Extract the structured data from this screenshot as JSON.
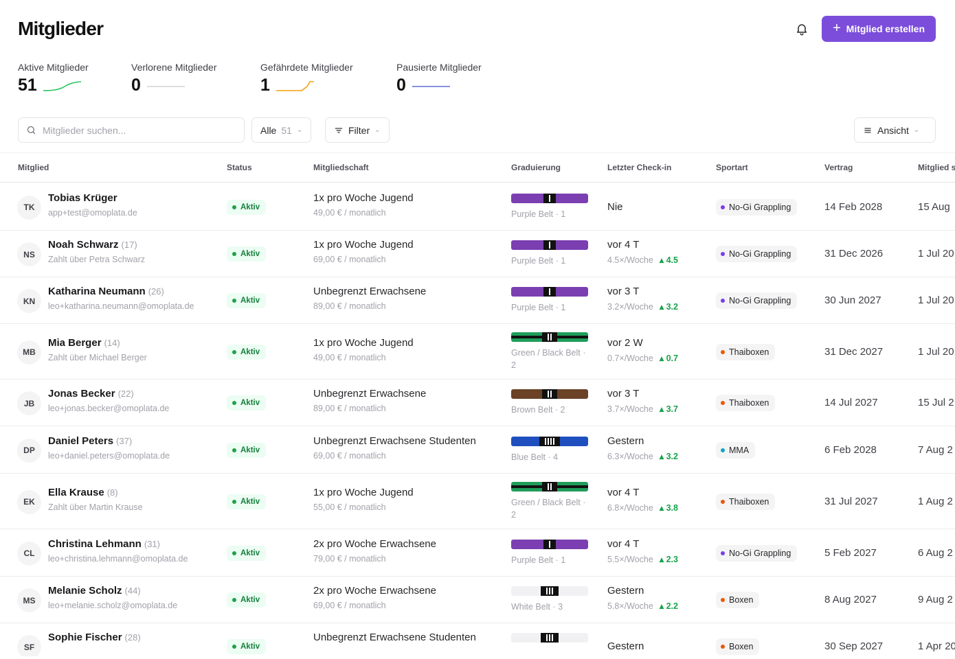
{
  "header": {
    "title": "Mitglieder",
    "create_label": "Mitglied erstellen"
  },
  "stats": [
    {
      "label": "Aktive Mitglieder",
      "value": "51",
      "color": "#22c55e"
    },
    {
      "label": "Verlorene Mitglieder",
      "value": "0",
      "color": "#d4d4d8"
    },
    {
      "label": "Gefährdete Mitglieder",
      "value": "1",
      "color": "#f59e0b"
    },
    {
      "label": "Pausierte Mitglieder",
      "value": "0",
      "color": "#5b6ed8"
    }
  ],
  "toolbar": {
    "search_placeholder": "Mitglieder suchen...",
    "all_label": "Alle",
    "all_count": "51",
    "filter_label": "Filter",
    "view_label": "Ansicht"
  },
  "columns": [
    "Mitglied",
    "Status",
    "Mitgliedschaft",
    "Graduierung",
    "Letzter Check-in",
    "Sportart",
    "Vertrag",
    "Mitglied s"
  ],
  "members": [
    {
      "initials": "TK",
      "name": "Tobias Krüger",
      "age": "",
      "sub": "app+test@omoplata.de",
      "status": "Aktiv",
      "plan": "1x pro Woche Jugend",
      "price": "49,00 € / monatlich",
      "belt": "Purple Belt · 1",
      "belt_main": "#7b3fb1",
      "belt_edge": "",
      "stripes": 1,
      "checkin": "Nie",
      "freq": "",
      "trend": "",
      "sport": "No-Gi Grappling",
      "sport_color": "#7c3aed",
      "contract": "14 Feb 2028",
      "since": "15 Aug"
    },
    {
      "initials": "NS",
      "name": "Noah Schwarz",
      "age": "(17)",
      "sub": "Zahlt über Petra Schwarz",
      "status": "Aktiv",
      "plan": "1x pro Woche Jugend",
      "price": "69,00 € / monatlich",
      "belt": "Purple Belt · 1",
      "belt_main": "#7b3fb1",
      "belt_edge": "",
      "stripes": 1,
      "checkin": "vor 4 T",
      "freq": "4.5×/Woche",
      "trend": "4.5",
      "sport": "No-Gi Grappling",
      "sport_color": "#7c3aed",
      "contract": "31 Dec 2026",
      "since": "1 Jul 20"
    },
    {
      "initials": "KN",
      "name": "Katharina Neumann",
      "age": "(26)",
      "sub": "leo+katharina.neumann@omoplata.de",
      "status": "Aktiv",
      "plan": "Unbegrenzt Erwachsene",
      "price": "89,00 € / monatlich",
      "belt": "Purple Belt · 1",
      "belt_main": "#7b3fb1",
      "belt_edge": "",
      "stripes": 1,
      "checkin": "vor 3 T",
      "freq": "3.2×/Woche",
      "trend": "3.2",
      "sport": "No-Gi Grappling",
      "sport_color": "#7c3aed",
      "contract": "30 Jun 2027",
      "since": "1 Jul 20"
    },
    {
      "initials": "MB",
      "name": "Mia Berger",
      "age": "(14)",
      "sub": "Zahlt über Michael Berger",
      "status": "Aktiv",
      "plan": "1x pro Woche Jugend",
      "price": "49,00 € / monatlich",
      "belt": "Green / Black Belt · 2",
      "belt_main": "#1f9d5a",
      "belt_edge": "#111111",
      "stripes": 2,
      "checkin": "vor 2 W",
      "freq": "0.7×/Woche",
      "trend": "0.7",
      "sport": "Thaiboxen",
      "sport_color": "#ea580c",
      "contract": "31 Dec 2027",
      "since": "1 Jul 20"
    },
    {
      "initials": "JB",
      "name": "Jonas Becker",
      "age": "(22)",
      "sub": "leo+jonas.becker@omoplata.de",
      "status": "Aktiv",
      "plan": "Unbegrenzt Erwachsene",
      "price": "89,00 € / monatlich",
      "belt": "Brown Belt · 2",
      "belt_main": "#6b4226",
      "belt_edge": "",
      "stripes": 2,
      "checkin": "vor 3 T",
      "freq": "3.7×/Woche",
      "trend": "3.7",
      "sport": "Thaiboxen",
      "sport_color": "#ea580c",
      "contract": "14 Jul 2027",
      "since": "15 Jul 2"
    },
    {
      "initials": "DP",
      "name": "Daniel Peters",
      "age": "(37)",
      "sub": "leo+daniel.peters@omoplata.de",
      "status": "Aktiv",
      "plan": "Unbegrenzt Erwachsene Studenten",
      "price": "69,00 € / monatlich",
      "belt": "Blue Belt · 4",
      "belt_main": "#1f4fbf",
      "belt_edge": "",
      "stripes": 4,
      "checkin": "Gestern",
      "freq": "6.3×/Woche",
      "trend": "3.2",
      "sport": "MMA",
      "sport_color": "#0ea5c6",
      "contract": "6 Feb 2028",
      "since": "7 Aug 2"
    },
    {
      "initials": "EK",
      "name": "Ella Krause",
      "age": "(8)",
      "sub": "Zahlt über Martin Krause",
      "status": "Aktiv",
      "plan": "1x pro Woche Jugend",
      "price": "55,00 € / monatlich",
      "belt": "Green / Black Belt · 2",
      "belt_main": "#1f9d5a",
      "belt_edge": "#111111",
      "stripes": 2,
      "checkin": "vor 4 T",
      "freq": "6.8×/Woche",
      "trend": "3.8",
      "sport": "Thaiboxen",
      "sport_color": "#ea580c",
      "contract": "31 Jul 2027",
      "since": "1 Aug 2"
    },
    {
      "initials": "CL",
      "name": "Christina Lehmann",
      "age": "(31)",
      "sub": "leo+christina.lehmann@omoplata.de",
      "status": "Aktiv",
      "plan": "2x pro Woche Erwachsene",
      "price": "79,00 € / monatlich",
      "belt": "Purple Belt · 1",
      "belt_main": "#7b3fb1",
      "belt_edge": "",
      "stripes": 1,
      "checkin": "vor 4 T",
      "freq": "5.5×/Woche",
      "trend": "2.3",
      "sport": "No-Gi Grappling",
      "sport_color": "#7c3aed",
      "contract": "5 Feb 2027",
      "since": "6 Aug 2"
    },
    {
      "initials": "MS",
      "name": "Melanie Scholz",
      "age": "(44)",
      "sub": "leo+melanie.scholz@omoplata.de",
      "status": "Aktiv",
      "plan": "2x pro Woche Erwachsene",
      "price": "69,00 € / monatlich",
      "belt": "White Belt · 3",
      "belt_main": "#f1f1f3",
      "belt_edge": "",
      "stripes": 3,
      "checkin": "Gestern",
      "freq": "5.8×/Woche",
      "trend": "2.2",
      "sport": "Boxen",
      "sport_color": "#ea580c",
      "contract": "8 Aug 2027",
      "since": "9 Aug 2"
    },
    {
      "initials": "SF",
      "name": "Sophie Fischer",
      "age": "(28)",
      "sub": "",
      "status": "Aktiv",
      "plan": "Unbegrenzt Erwachsene Studenten",
      "price": "",
      "belt": "",
      "belt_main": "#f1f1f3",
      "belt_edge": "",
      "stripes": 3,
      "checkin": "Gestern",
      "freq": "",
      "trend": "",
      "sport": "Boxen",
      "sport_color": "#ea580c",
      "contract": "30 Sep 2027",
      "since": "1 Apr 20"
    }
  ]
}
